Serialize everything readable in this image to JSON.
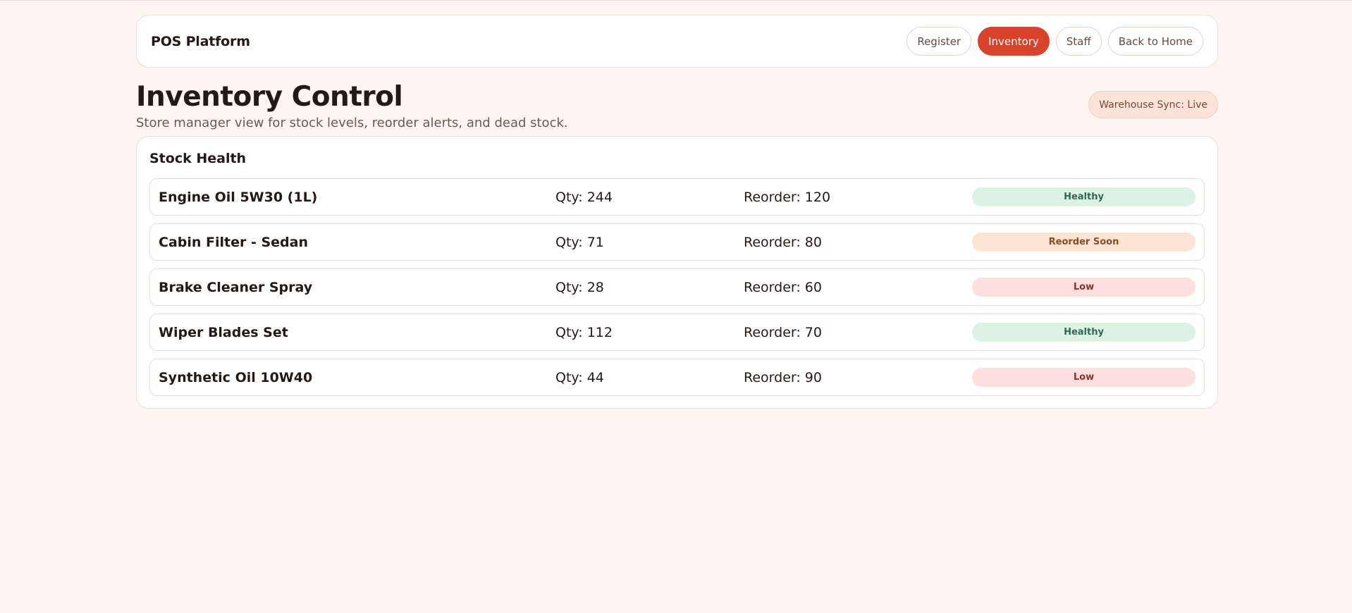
{
  "navbar": {
    "brand": "POS Platform",
    "links": [
      {
        "label": "Register",
        "active": false
      },
      {
        "label": "Inventory",
        "active": true
      },
      {
        "label": "Staff",
        "active": false
      },
      {
        "label": "Back to Home",
        "active": false
      }
    ]
  },
  "header": {
    "title": "Inventory Control",
    "subtitle": "Store manager view for stock levels, reorder alerts, and dead stock.",
    "sync_badge": "Warehouse Sync: Live"
  },
  "panel": {
    "title": "Stock Health",
    "items": [
      {
        "name": "Engine Oil 5W30 (1L)",
        "qty": "Qty: 244",
        "reorder": "Reorder: 120",
        "status": "Healthy",
        "status_kind": "healthy"
      },
      {
        "name": "Cabin Filter - Sedan",
        "qty": "Qty: 71",
        "reorder": "Reorder: 80",
        "status": "Reorder Soon",
        "status_kind": "soon"
      },
      {
        "name": "Brake Cleaner Spray",
        "qty": "Qty: 28",
        "reorder": "Reorder: 60",
        "status": "Low",
        "status_kind": "low"
      },
      {
        "name": "Wiper Blades Set",
        "qty": "Qty: 112",
        "reorder": "Reorder: 70",
        "status": "Healthy",
        "status_kind": "healthy"
      },
      {
        "name": "Synthetic Oil 10W40",
        "qty": "Qty: 44",
        "reorder": "Reorder: 90",
        "status": "Low",
        "status_kind": "low"
      }
    ]
  },
  "colors": {
    "accent": "#d9432c",
    "background": "#fdf5f0",
    "healthy_bg": "#ddf2e4",
    "soon_bg": "#fde4d4",
    "low_bg": "#fde0dd"
  }
}
